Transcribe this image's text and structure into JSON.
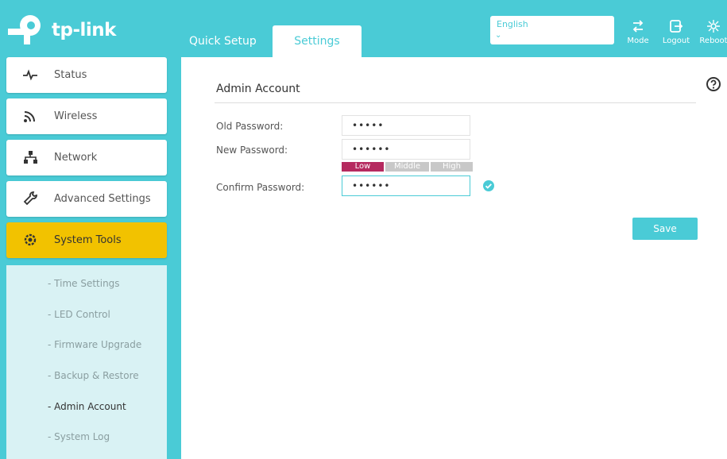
{
  "brand": {
    "name": "tp-link"
  },
  "tabs": [
    {
      "label": "Quick Setup",
      "active": false
    },
    {
      "label": "Settings",
      "active": true
    }
  ],
  "language": {
    "selected": "English"
  },
  "header_actions": [
    {
      "label": "Mode",
      "icon": "mode-icon"
    },
    {
      "label": "Logout",
      "icon": "logout-icon"
    },
    {
      "label": "Reboot",
      "icon": "reboot-icon"
    }
  ],
  "sidebar": {
    "items": [
      {
        "label": "Status",
        "icon": "pulse-icon"
      },
      {
        "label": "Wireless",
        "icon": "wifi-icon"
      },
      {
        "label": "Network",
        "icon": "network-icon"
      },
      {
        "label": "Advanced Settings",
        "icon": "wrench-icon"
      },
      {
        "label": "System Tools",
        "icon": "gear-icon",
        "active": true
      }
    ],
    "submenu": [
      {
        "label": "- Time Settings"
      },
      {
        "label": "- LED Control"
      },
      {
        "label": "- Firmware Upgrade"
      },
      {
        "label": "- Backup & Restore"
      },
      {
        "label": "- Admin Account",
        "active": true
      },
      {
        "label": "- System Log"
      }
    ]
  },
  "main": {
    "title": "Admin Account",
    "fields": {
      "old_password": {
        "label": "Old Password:",
        "value": "•••••"
      },
      "new_password": {
        "label": "New Password:",
        "value": "••••••"
      },
      "confirm_password": {
        "label": "Confirm Password:",
        "value": "••••••"
      }
    },
    "strength": {
      "low": "Low",
      "middle": "Middle",
      "high": "High",
      "level": "Low"
    },
    "save_label": "Save"
  },
  "colors": {
    "brand": "#4acbd6",
    "active_menu": "#f2c200",
    "strength_low": "#b52a5f"
  }
}
